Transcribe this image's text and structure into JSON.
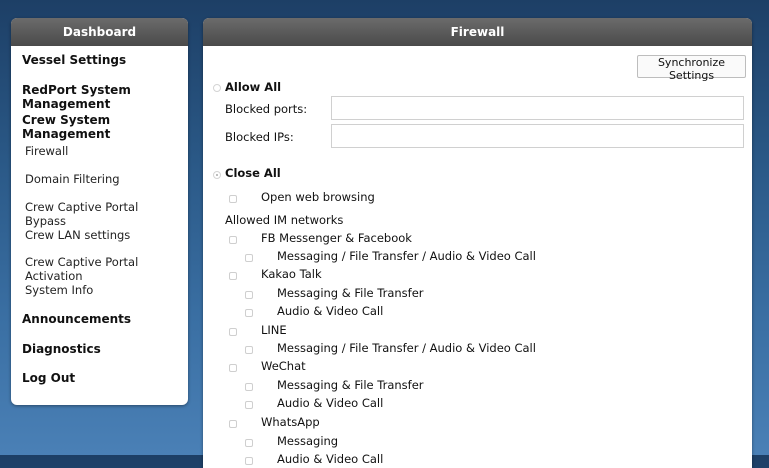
{
  "sidebar": {
    "title": "Dashboard",
    "items": [
      {
        "label": "Vessel Settings",
        "bold": true
      },
      {
        "label": "RedPort System Management",
        "bold": true
      },
      {
        "label": "Crew System Management",
        "bold": true
      },
      {
        "label": "Firewall",
        "bold": false
      },
      {
        "label": "Domain Filtering",
        "bold": false
      },
      {
        "label": "Crew Captive Portal Bypass",
        "bold": false
      },
      {
        "label": "Crew LAN settings",
        "bold": false
      },
      {
        "label": "Crew Captive Portal Activation",
        "bold": false
      },
      {
        "label": "System Info",
        "bold": false
      },
      {
        "label": "Announcements",
        "bold": true
      },
      {
        "label": "Diagnostics",
        "bold": true
      },
      {
        "label": "Log Out",
        "bold": true
      }
    ]
  },
  "main": {
    "title": "Firewall",
    "sync_button": "Synchronize Settings",
    "allow_all": {
      "label": "Allow All",
      "checked": false,
      "blocked_ports_label": "Blocked ports:",
      "blocked_ports_value": "",
      "blocked_ips_label": "Blocked IPs:",
      "blocked_ips_value": ""
    },
    "close_all": {
      "label": "Close All",
      "checked": true,
      "open_web_browsing": "Open web browsing",
      "allowed_im_label": "Allowed IM networks",
      "networks": [
        {
          "name": "FB Messenger & Facebook",
          "options": [
            "Messaging / File Transfer / Audio & Video Call"
          ]
        },
        {
          "name": "Kakao Talk",
          "options": [
            "Messaging & File Transfer",
            "Audio & Video Call"
          ]
        },
        {
          "name": "LINE",
          "options": [
            "Messaging / File Transfer / Audio & Video Call"
          ]
        },
        {
          "name": "WeChat",
          "options": [
            "Messaging & File Transfer",
            "Audio & Video Call"
          ]
        },
        {
          "name": "WhatsApp",
          "options": [
            "Messaging",
            "Audio & Video Call"
          ]
        }
      ]
    }
  }
}
